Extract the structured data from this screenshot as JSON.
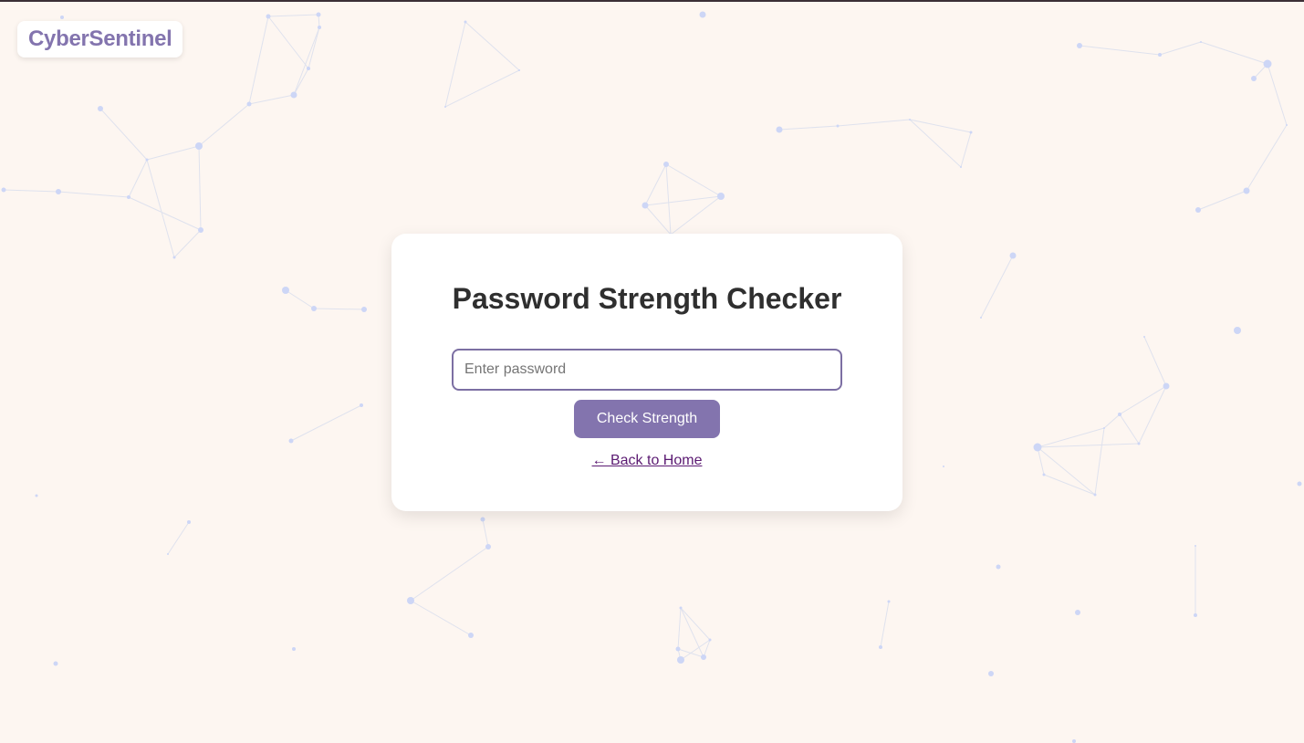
{
  "brand": {
    "name": "CyberSentinel"
  },
  "checker": {
    "title": "Password Strength Checker",
    "input_placeholder": "Enter password",
    "input_value": "",
    "button_label": "Check Strength",
    "back_link_label": "← Back to Home"
  },
  "colors": {
    "page_background": "#fdf6f1",
    "accent": "#8374ae",
    "title_text": "#2f2f2f",
    "link": "#5b1a72",
    "network_node": "#cdd6f6",
    "network_line": "#dfe2ee"
  }
}
